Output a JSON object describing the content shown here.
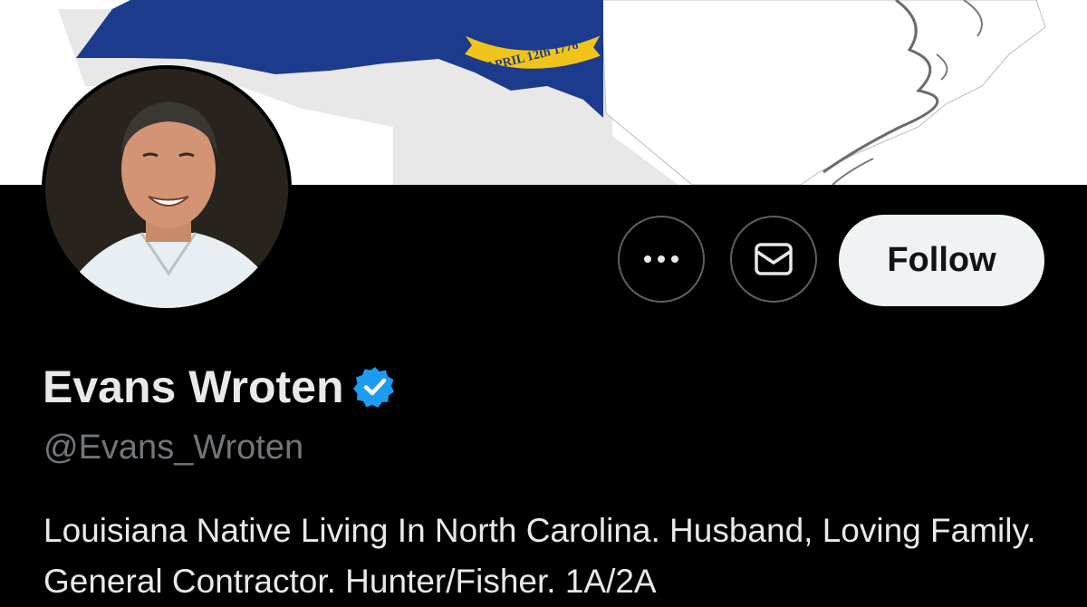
{
  "banner": {
    "flag_text": "APRIL 12th 1776",
    "colors": {
      "navy": "#1d3b8c",
      "gold": "#f0c419",
      "white": "#ffffff"
    }
  },
  "profile": {
    "display_name": "Evans Wroten",
    "handle": "@Evans_Wroten",
    "verified": true,
    "bio": "Louisiana Native Living In North Carolina. Husband, Loving Family. General Contractor. Hunter/Fisher. 1A/2A"
  },
  "actions": {
    "more_icon": "more-horizontal-icon",
    "message_icon": "envelope-icon",
    "follow_label": "Follow"
  },
  "theme": {
    "background": "#000000",
    "text_primary": "#e7e9ea",
    "text_secondary": "#71767b",
    "verified_blue": "#1d9bf0",
    "button_border": "#5b6166",
    "follow_bg": "#eff3f4"
  }
}
